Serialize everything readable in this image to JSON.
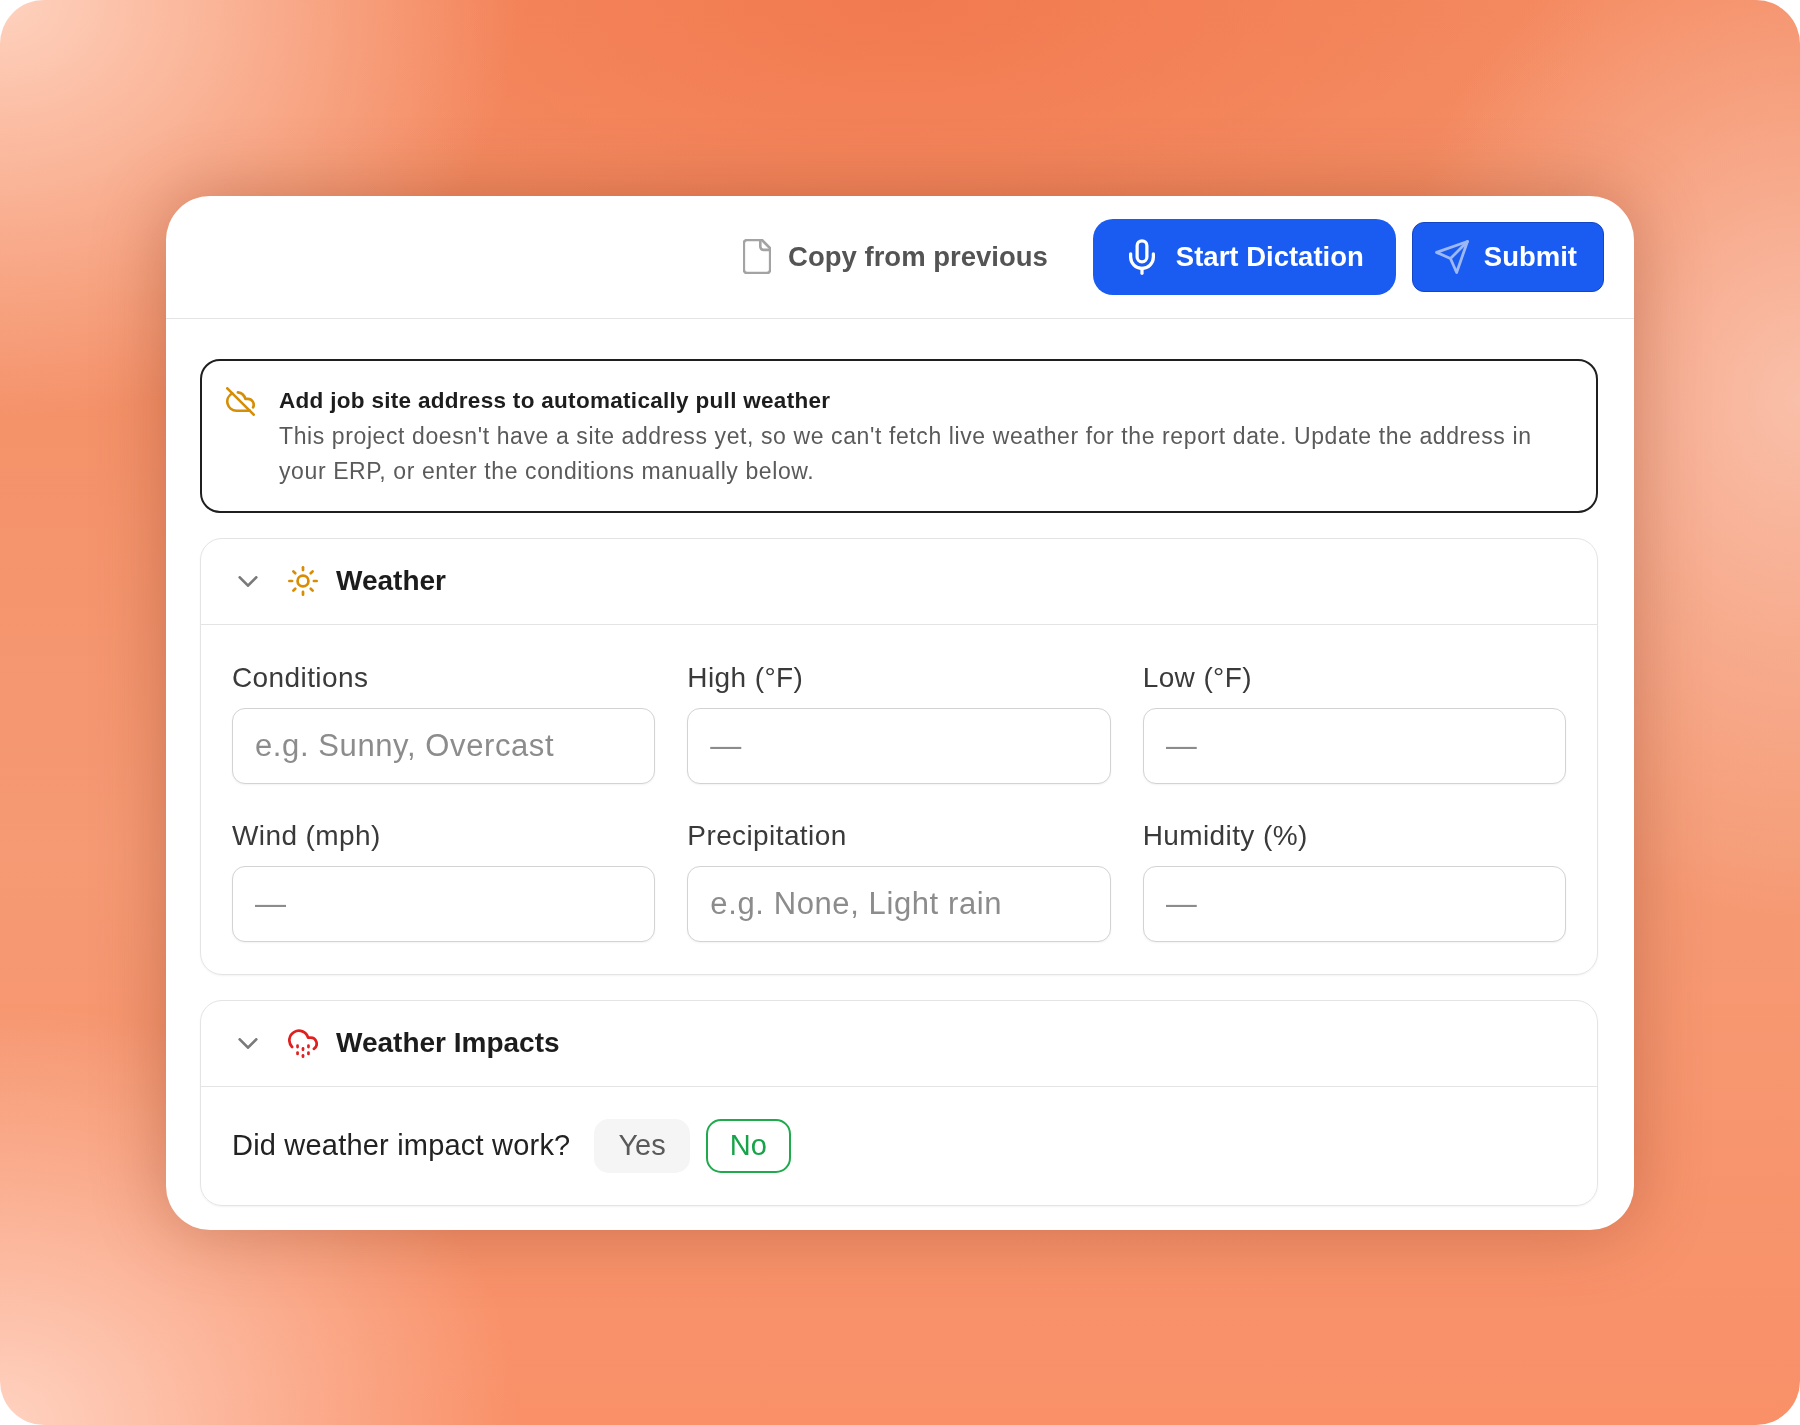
{
  "toolbar": {
    "actions": [
      {
        "label": "Copy from previous",
        "kind": "ghost"
      },
      {
        "label": "Start Dictation",
        "kind": "primary"
      },
      {
        "label": "Submit",
        "kind": "outlined"
      }
    ]
  },
  "notice": {
    "title": "Add job site address to automatically pull weather",
    "body": "This project doesn't have a site address yet, so we can't fetch live weather for the report date. Update the address in your ERP, or enter the conditions manually below."
  },
  "sections": [
    {
      "title": "Weather",
      "expanded": true,
      "kind": "fields",
      "fields": [
        {
          "label": "Conditions",
          "placeholder": "e.g. Sunny, Overcast"
        },
        {
          "label": "High (°F)",
          "placeholder": "—"
        },
        {
          "label": "Low (°F)",
          "placeholder": "—"
        },
        {
          "label": "Wind (mph)",
          "placeholder": "—"
        },
        {
          "label": "Precipitation",
          "placeholder": "e.g. None, Light rain"
        },
        {
          "label": "Humidity (%)",
          "placeholder": "—"
        }
      ]
    },
    {
      "title": "Weather Impacts",
      "expanded": true,
      "kind": "choice",
      "question": "Did weather impact work?",
      "options": [
        {
          "label": "Yes",
          "selected": false
        },
        {
          "label": "No",
          "selected": true
        }
      ]
    }
  ]
}
